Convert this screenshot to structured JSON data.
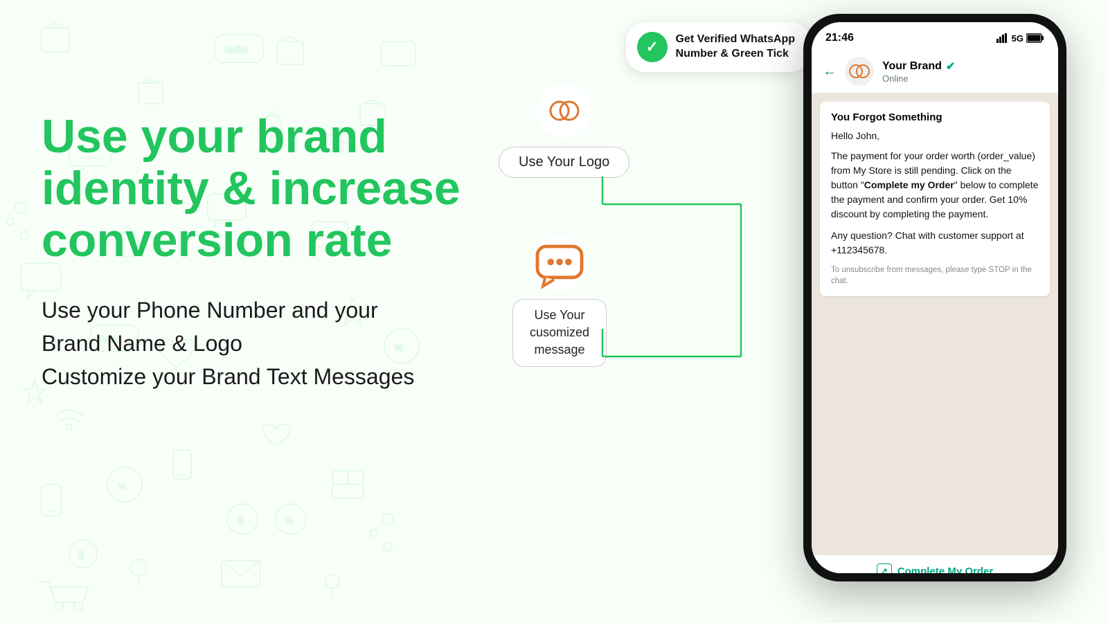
{
  "background": {
    "color": "#f8fff8"
  },
  "heading": {
    "line1": "Use your brand",
    "line2": "identity & increase",
    "line3": "conversion rate"
  },
  "subtext": {
    "line1": "Use your Phone Number and your",
    "line2": "Brand Name & Logo",
    "line3": "Customize your Brand Text Messages"
  },
  "floatingElements": {
    "logoLabel": "Use Your Logo",
    "messageLabel": "Use Your\ncusomized\nmessage"
  },
  "callout": {
    "line1": "Get Verified WhatsApp",
    "line2": "Number & Green Tick"
  },
  "phone": {
    "time": "21:46",
    "signal": "5G",
    "contactName": "Your Brand",
    "contactStatus": "Online",
    "messageTitle": "You Forgot Something",
    "messageBody1": "Hello John,",
    "messageBody2": "The payment for your order worth (order_value) from My Store is still pending. Click on the button “Complete my Order” below to complete the payment and confirm your order. Get 10% discount by completing the payment.",
    "messageBody3": "Any question? Chat with customer support at +112345678.",
    "disclaimer": "To unsubscribe from messages, please type STOP in the chat.",
    "ctaButton": "Complete My Order"
  }
}
